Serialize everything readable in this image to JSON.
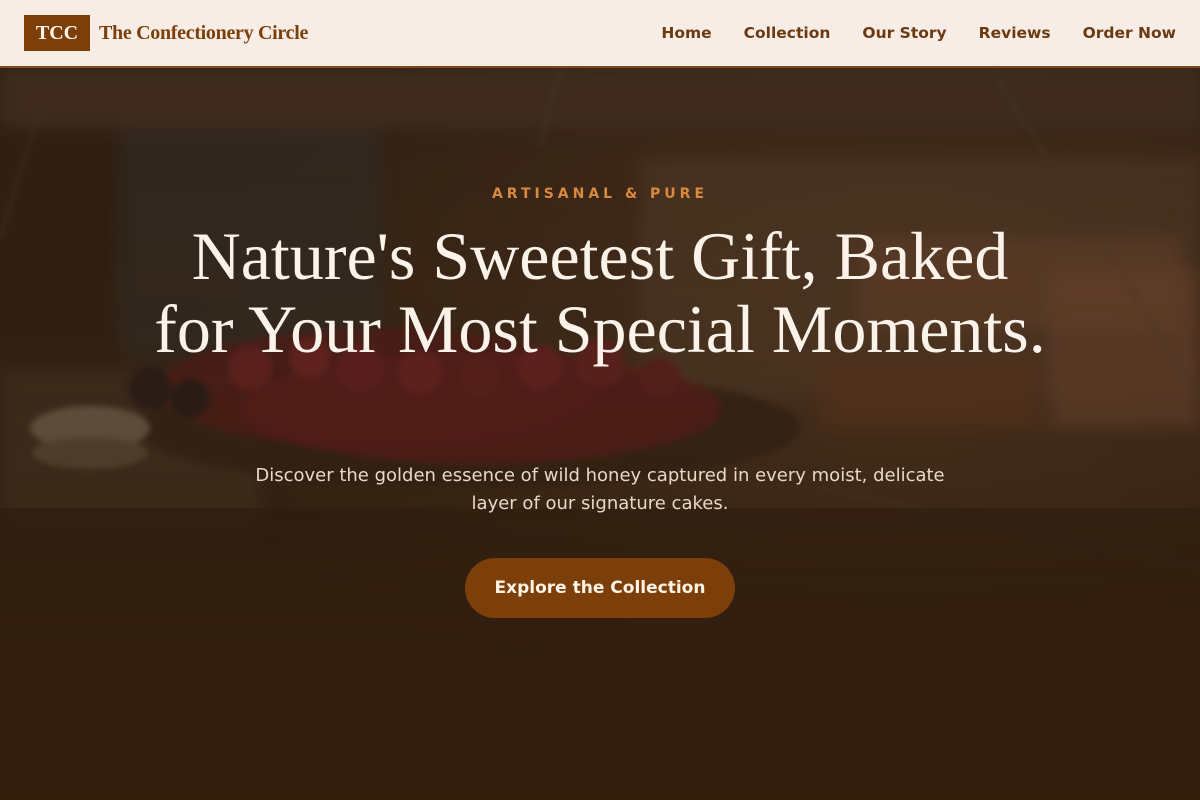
{
  "header": {
    "logo_text": "TCC",
    "brand_name": "The Confectionery Circle",
    "nav": [
      "Home",
      "Collection",
      "Our Story",
      "Reviews",
      "Order Now"
    ]
  },
  "hero": {
    "eyebrow": "ARTISANAL & PURE",
    "headline": "Nature's Sweetest Gift, Baked for Your Most Special Moments.",
    "subtext": "Discover the golden essence of wild honey captured in every moist, delicate layer of our signature cakes.",
    "cta_label": "Explore the Collection"
  },
  "colors": {
    "brand_brown": "#7c3f0a",
    "header_bg": "#f8ede6",
    "accent_orange": "#d98a3e",
    "hero_text": "#fbf3ea"
  }
}
